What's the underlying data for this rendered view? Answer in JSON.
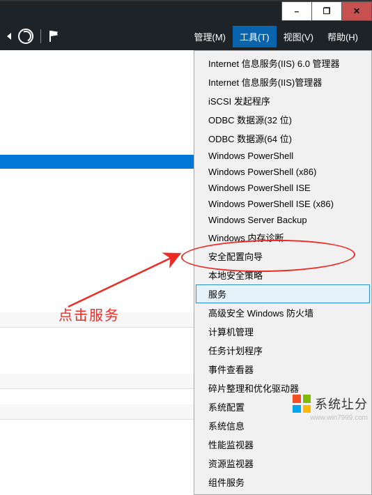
{
  "window_controls": {
    "minimize": "–",
    "maximize": "❐",
    "close": "✕"
  },
  "menubar": {
    "manage": "管理(M)",
    "tools": "工具(T)",
    "view": "视图(V)",
    "help": "帮助(H)"
  },
  "dropdown": {
    "items": [
      "Internet 信息服务(IIS) 6.0 管理器",
      "Internet 信息服务(IIS)管理器",
      "iSCSI 发起程序",
      "ODBC 数据源(32 位)",
      "ODBC 数据源(64 位)",
      "Windows PowerShell",
      "Windows PowerShell (x86)",
      "Windows PowerShell ISE",
      "Windows PowerShell ISE (x86)",
      "Windows Server Backup",
      "Windows 内存诊断",
      "安全配置向导",
      "本地安全策略",
      "服务",
      "高级安全 Windows 防火墙",
      "计算机管理",
      "任务计划程序",
      "事件查看器",
      "碎片整理和优化驱动器",
      "系统配置",
      "系统信息",
      "性能监视器",
      "资源监视器",
      "组件服务"
    ],
    "highlight_index": 13
  },
  "annotation": {
    "text": "点击服务"
  },
  "watermark": {
    "brand": "系统圵分",
    "url": "www.win7999.com",
    "logo_colors": [
      "#f25022",
      "#7fba00",
      "#00a4ef",
      "#ffb900"
    ]
  }
}
